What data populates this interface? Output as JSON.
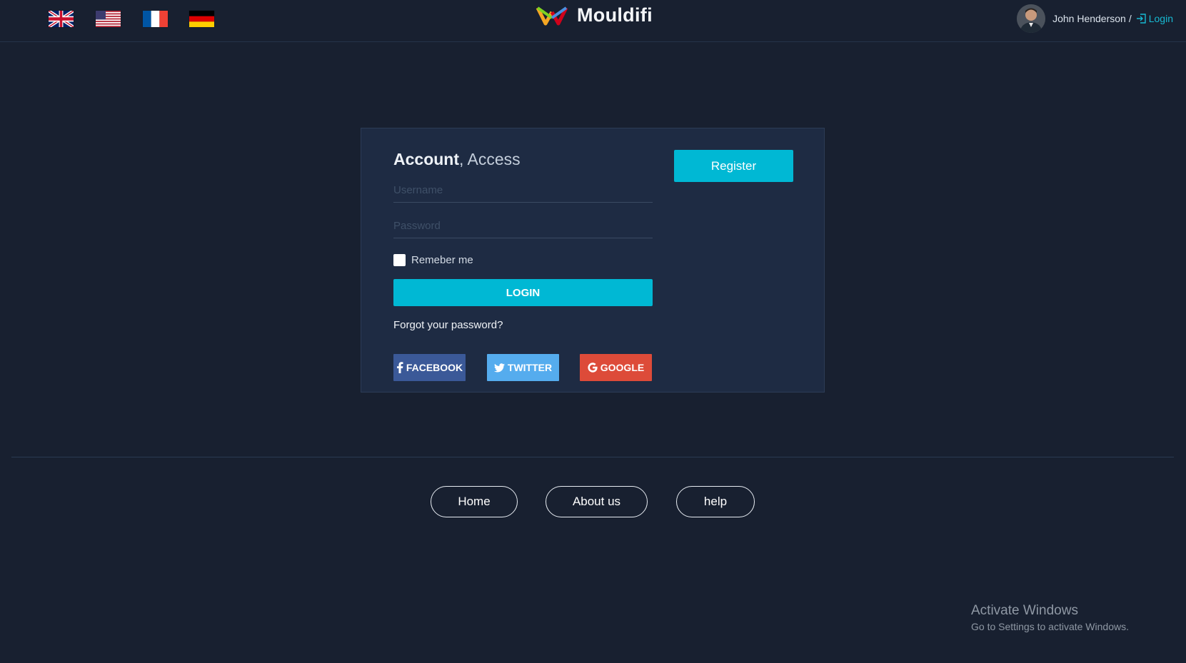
{
  "header": {
    "flags": [
      {
        "name": "united-kingdom",
        "label": "English (UK)"
      },
      {
        "name": "united-states",
        "label": "English (US)"
      },
      {
        "name": "france",
        "label": "Français"
      },
      {
        "name": "germany",
        "label": "Deutsch"
      }
    ],
    "brand": "Mouldifi",
    "user_name": "John Henderson",
    "separator": "/",
    "login_label": "Login"
  },
  "card": {
    "title_bold": "Account",
    "title_light": ", Access",
    "username_placeholder": "Username",
    "password_placeholder": "Password",
    "remember_label": "Remeber me",
    "login_button": "LOGIN",
    "forgot_password": "Forgot your password?",
    "social": {
      "facebook": "FACEBOOK",
      "twitter": "TWITTER",
      "google": "GOOGLE"
    },
    "register_button": "Register"
  },
  "footer": {
    "links": [
      "Home",
      "About us",
      "help"
    ]
  },
  "watermark": {
    "line1": "Activate Windows",
    "line2": "Go to Settings to activate Windows."
  },
  "colors": {
    "background": "#182030",
    "card": "#1e2b43",
    "accent": "#00b8d4",
    "facebook": "#3b5998",
    "twitter": "#55acee",
    "google": "#dd4b39"
  }
}
